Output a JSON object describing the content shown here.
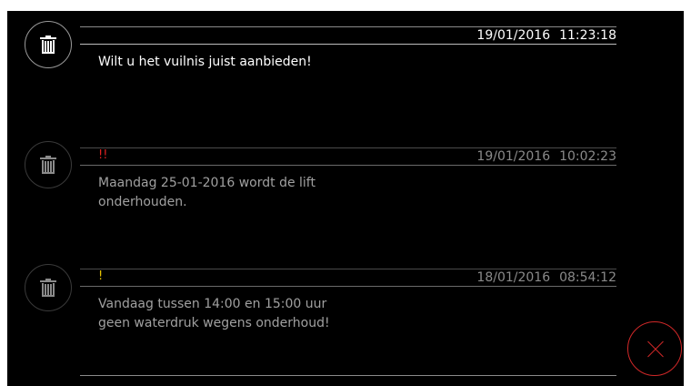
{
  "messages": [
    {
      "priority": "",
      "date": "19/01/2016",
      "time": "11:23:18",
      "text_lines": [
        "Wilt u het vuilnis juist aanbieden!"
      ],
      "delete_icon": "trash-icon"
    },
    {
      "priority": "!!",
      "date": "19/01/2016",
      "time": "10:02:23",
      "text_lines": [
        "Maandag 25-01-2016 wordt de lift",
        "onderhouden."
      ],
      "delete_icon": "trash-icon"
    },
    {
      "priority": "!",
      "date": "18/01/2016",
      "time": "08:54:12",
      "text_lines": [
        "Vandaag tussen 14:00 en 15:00 uur",
        "geen waterdruk wegens onderhoud!"
      ],
      "delete_icon": "trash-icon"
    }
  ],
  "colors": {
    "background": "#000000",
    "priority_high": "#e02020",
    "priority_medium": "#e6c200",
    "close_accent": "#d02828"
  },
  "close_icon": "close-x-icon"
}
